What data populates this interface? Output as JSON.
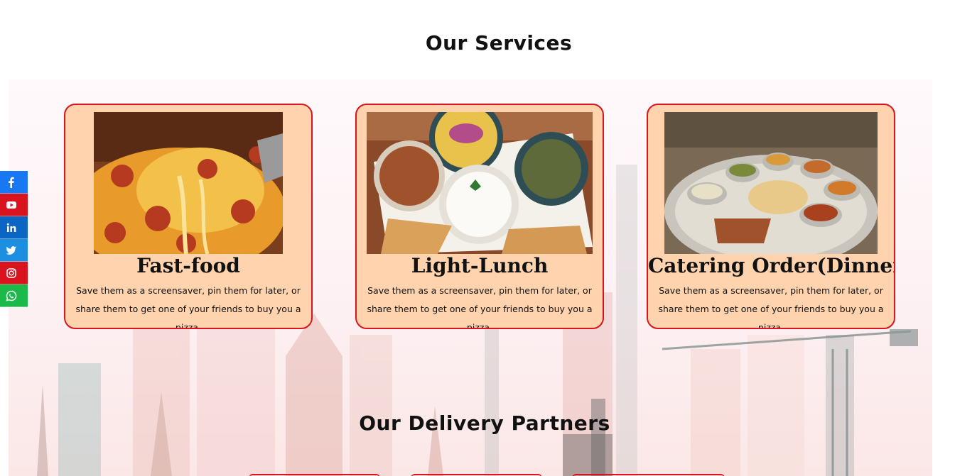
{
  "services": {
    "title": "Our Services",
    "cards": [
      {
        "title": "Fast-food",
        "description": "Save them as a screensaver, pin them for later, or share them to get one of your friends to buy you a pizza.",
        "image": "pizza-photo"
      },
      {
        "title": "Light-Lunch",
        "description": "Save them as a screensaver, pin them for later, or share them to get one of your friends to buy you a pizza.",
        "image": "thali-bowls-photo"
      },
      {
        "title": "Catering Order(Dinner)",
        "description": "Save them as a screensaver, pin them for later, or share them to get one of your friends to buy you a pizza.",
        "image": "dinner-platter-photo"
      }
    ]
  },
  "partners": {
    "title": "Our Delivery Partners"
  },
  "social": [
    {
      "icon": "facebook-icon",
      "color": "#1877f2"
    },
    {
      "icon": "youtube-icon",
      "color": "#d9141e"
    },
    {
      "icon": "linkedin-icon",
      "color": "#0a66c2"
    },
    {
      "icon": "twitter-icon",
      "color": "#1d8fe0"
    },
    {
      "icon": "instagram-icon",
      "color": "#d9141e"
    },
    {
      "icon": "whatsapp-icon",
      "color": "#1bb94a"
    }
  ]
}
